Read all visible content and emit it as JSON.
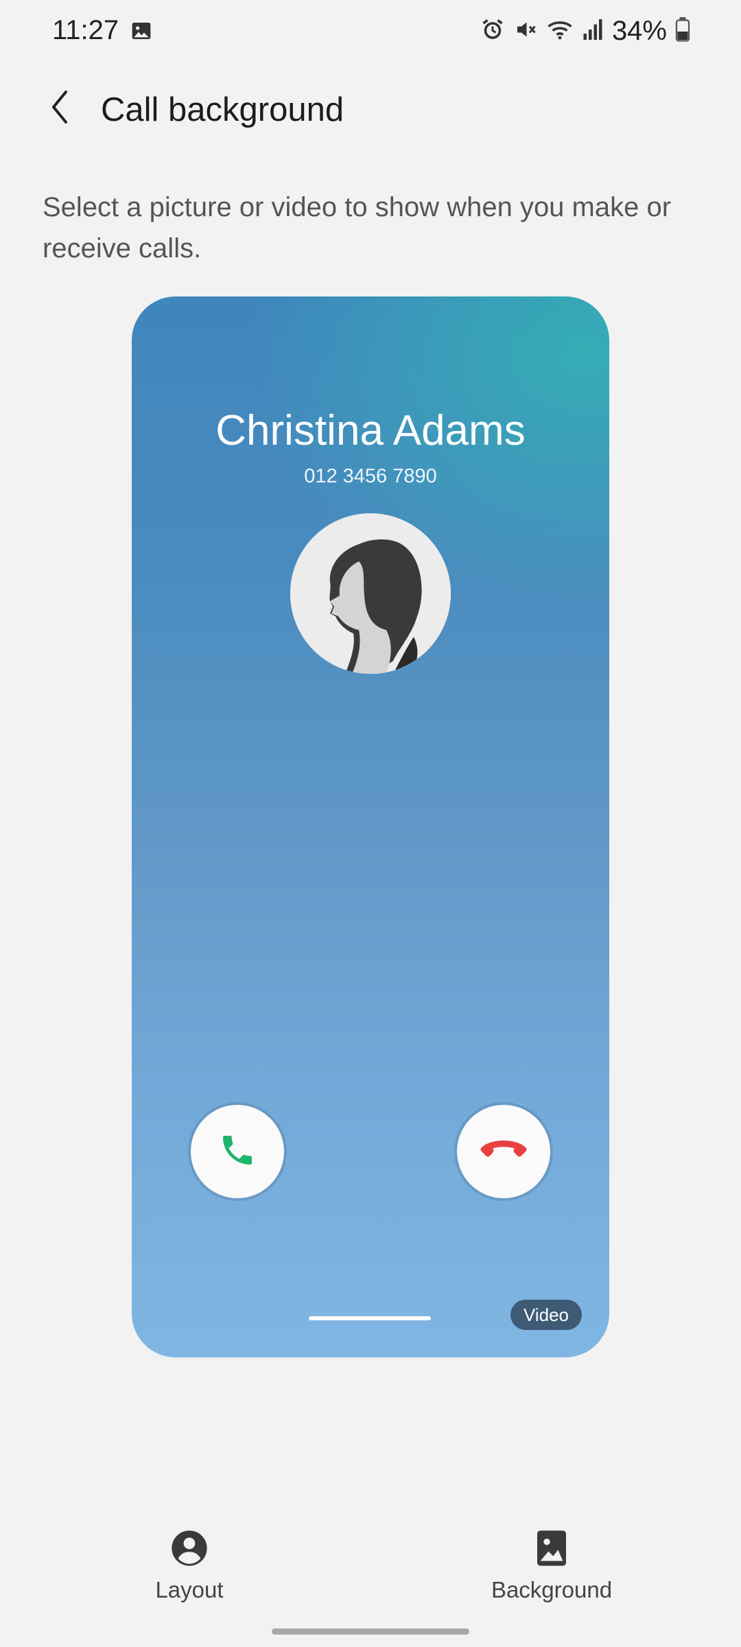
{
  "status_bar": {
    "time": "11:27",
    "battery": "34%",
    "icons": [
      "image-icon",
      "alarm-icon",
      "mute-icon",
      "wifi-icon",
      "signal-icon",
      "battery-icon"
    ]
  },
  "header": {
    "title": "Call background",
    "back_icon": "chevron-left-icon"
  },
  "description": "Select a picture or video to show when you make or receive calls.",
  "preview": {
    "caller_name": "Christina Adams",
    "caller_number": "012 3456 7890",
    "badge": "Video",
    "accept_icon": "phone-accept-icon",
    "decline_icon": "phone-decline-icon",
    "colors": {
      "accept": "#1fb56b",
      "decline": "#e8403f",
      "bg_top": "#3f86bd",
      "bg_bottom": "#80b6e2"
    }
  },
  "bottom_nav": {
    "items": [
      {
        "label": "Layout",
        "icon": "person-circle-icon"
      },
      {
        "label": "Background",
        "icon": "image-icon"
      }
    ]
  }
}
